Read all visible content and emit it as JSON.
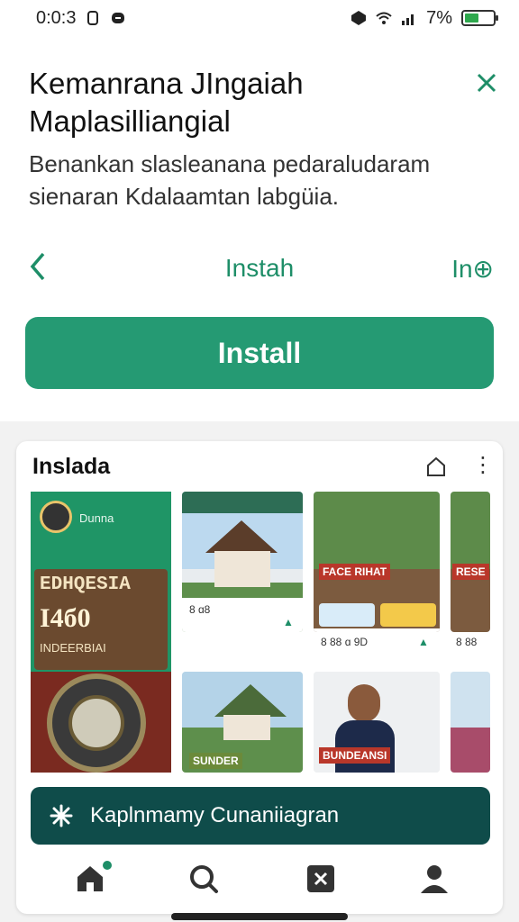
{
  "status_bar": {
    "time": "0:0:3",
    "battery": "7%",
    "battery_fill": 0.5
  },
  "sheet": {
    "title_line1": "Kemanrana JIngaiah",
    "title_line2": "Maplasilliangial",
    "description": "Benankan slasleanana pedaraludaram sienaran Kdalaamtan labgüia.",
    "middle_link": "Instah",
    "right_link": "In⊕",
    "install_label": "Install"
  },
  "card": {
    "title": "Inslada",
    "hero": {
      "small_text": "Dunna",
      "line1": "EDHQESIA",
      "line2": "I4б0",
      "line3": "INDEERBIAI"
    },
    "tiles": [
      {
        "info": "8 ɑ8",
        "label": ""
      },
      {
        "info": "8 88 ɑ 9D",
        "label": "FACE RIHAT"
      },
      {
        "info": "8 88",
        "label": "RESE"
      },
      {
        "info": "",
        "label": "SUNDER"
      },
      {
        "info": "",
        "label": "BUNDEANSI"
      }
    ],
    "banner_text": "Kaplnmamy Cunaniiagran"
  },
  "colors": {
    "accent": "#259a73",
    "accent_text": "#1e8e68",
    "dark_banner": "#0f4c4a"
  },
  "icons": {
    "close": "close-icon",
    "back": "chevron-left-icon",
    "home": "home-icon",
    "search": "search-icon",
    "box": "close-box-icon",
    "profile": "person-icon"
  }
}
